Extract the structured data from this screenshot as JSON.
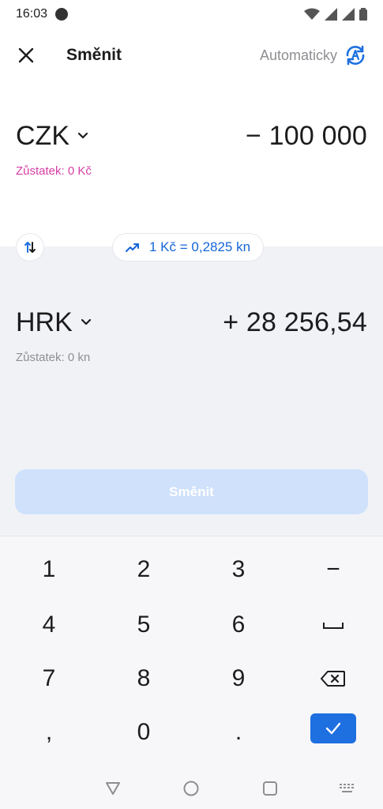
{
  "status": {
    "time": "16:03"
  },
  "header": {
    "title": "Směnit",
    "auto_label": "Automaticky"
  },
  "from": {
    "currency": "CZK",
    "amount": "− 100 000",
    "balance": "Zůstatek: 0 Kč"
  },
  "to": {
    "currency": "HRK",
    "amount": "+ 28 256,54",
    "balance": "Zůstatek: 0 kn"
  },
  "rate": {
    "text": "1 Kč = 0,2825 kn"
  },
  "action": {
    "exchange_label": "Směnit"
  },
  "keypad": {
    "k1": "1",
    "k2": "2",
    "k3": "3",
    "minus": "−",
    "k4": "4",
    "k5": "5",
    "k6": "6",
    "k7": "7",
    "k8": "8",
    "k9": "9",
    "comma": ",",
    "k0": "0",
    "dot": "."
  },
  "colors": {
    "accent": "#1e6fe0",
    "balance_warning": "#d63fa6",
    "button_disabled": "#cfe1fb"
  }
}
